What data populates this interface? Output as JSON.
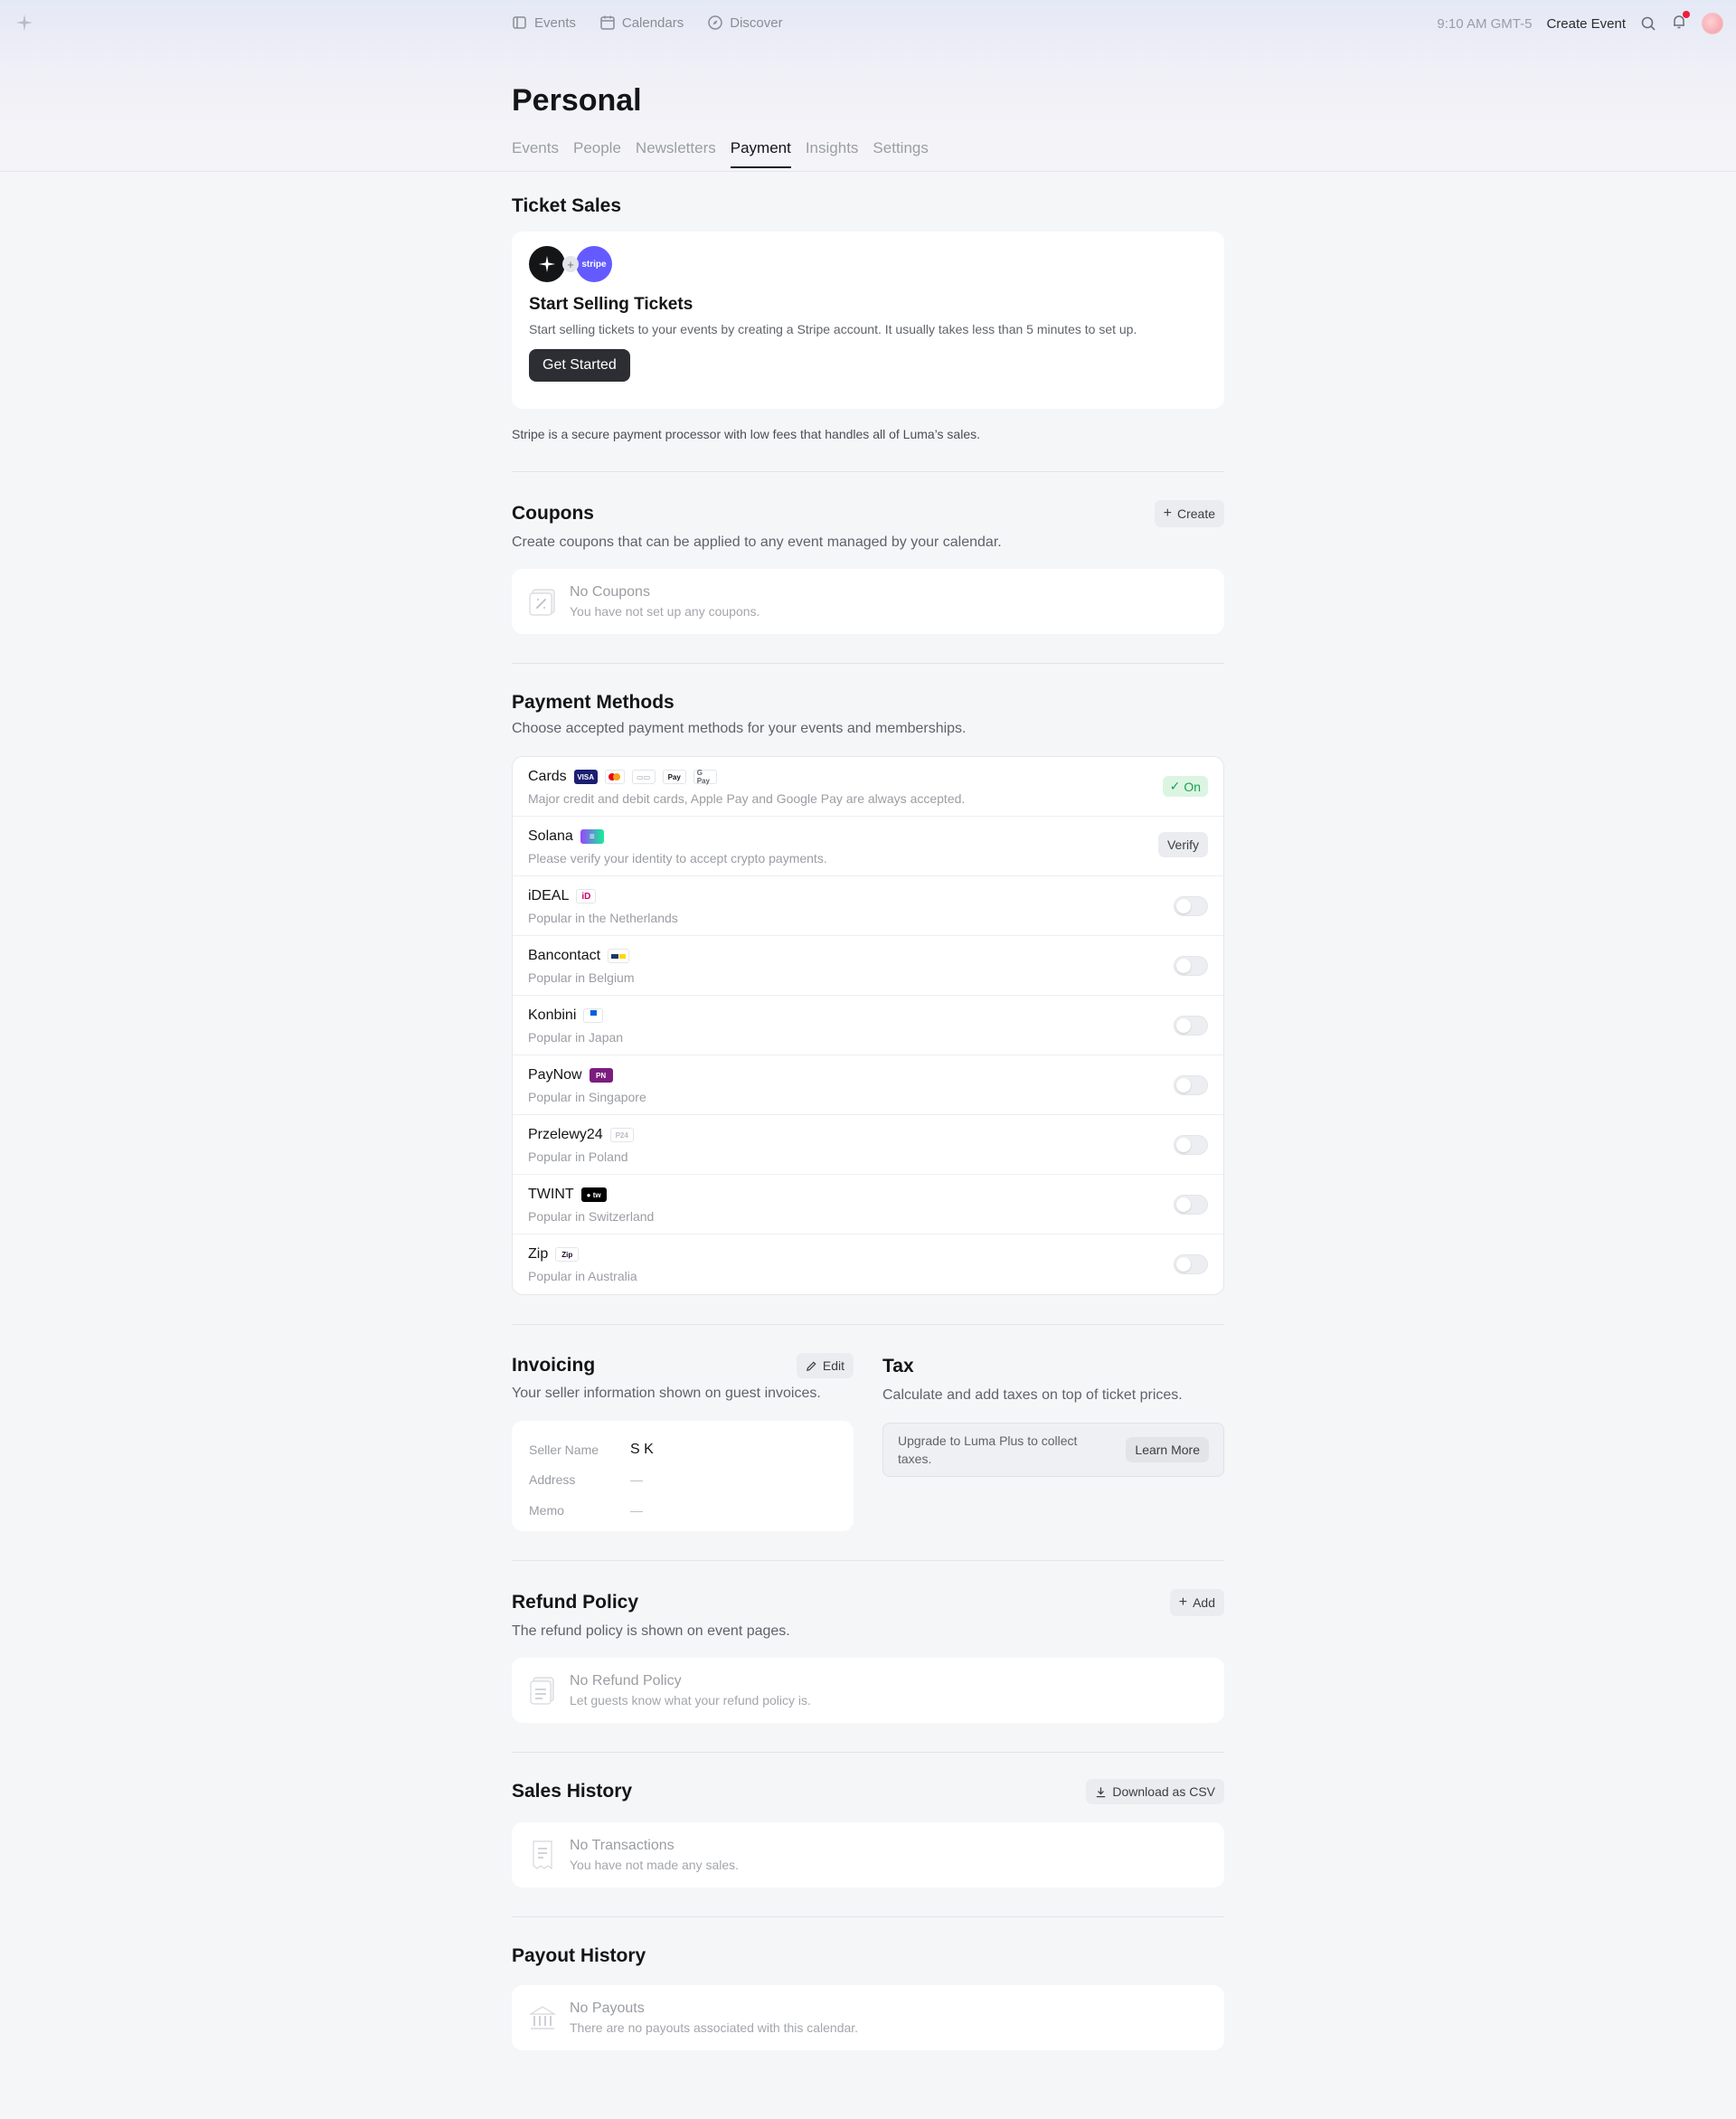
{
  "topbar": {
    "nav": [
      {
        "label": "Events",
        "icon": "ticket-icon"
      },
      {
        "label": "Calendars",
        "icon": "calendar-icon"
      },
      {
        "label": "Discover",
        "icon": "compass-icon"
      }
    ],
    "time": "9:10 AM GMT-5",
    "create_event": "Create Event"
  },
  "page": {
    "title": "Personal",
    "tabs": [
      "Events",
      "People",
      "Newsletters",
      "Payment",
      "Insights",
      "Settings"
    ],
    "active_tab": "Payment"
  },
  "ticket_sales": {
    "heading": "Ticket Sales",
    "stripe_label": "stripe",
    "card_title": "Start Selling Tickets",
    "card_desc": "Start selling tickets to your events by creating a Stripe account. It usually takes less than 5 minutes to set up.",
    "button": "Get Started",
    "footnote": "Stripe is a secure payment processor with low fees that handles all of Luma’s sales."
  },
  "coupons": {
    "heading": "Coupons",
    "button": "Create",
    "desc": "Create coupons that can be applied to any event managed by your calendar.",
    "empty_title": "No Coupons",
    "empty_sub": "You have not set up any coupons."
  },
  "payment_methods": {
    "heading": "Payment Methods",
    "desc": "Choose accepted payment methods for your events and memberships.",
    "cards": {
      "name": "Cards",
      "desc": "Major credit and debit cards, Apple Pay and Google Pay are always accepted.",
      "status": "On",
      "status_color": "#16a34a"
    },
    "solana": {
      "name": "Solana",
      "desc": "Please verify your identity to accept crypto payments.",
      "button": "Verify"
    },
    "methods": [
      {
        "name": "iDEAL",
        "desc": "Popular in the Netherlands",
        "enabled": false
      },
      {
        "name": "Bancontact",
        "desc": "Popular in Belgium",
        "enabled": false
      },
      {
        "name": "Konbini",
        "desc": "Popular in Japan",
        "enabled": false
      },
      {
        "name": "PayNow",
        "desc": "Popular in Singapore",
        "enabled": false
      },
      {
        "name": "Przelewy24",
        "desc": "Popular in Poland",
        "enabled": false
      },
      {
        "name": "TWINT",
        "desc": "Popular in Switzerland",
        "enabled": false
      },
      {
        "name": "Zip",
        "desc": "Popular in Australia",
        "enabled": false
      }
    ]
  },
  "invoicing": {
    "heading": "Invoicing",
    "button": "Edit",
    "desc": "Your seller information shown on guest invoices.",
    "seller_name_label": "Seller Name",
    "seller_name": "S K",
    "address_label": "Address",
    "address": "—",
    "memo_label": "Memo",
    "memo": "—"
  },
  "tax": {
    "heading": "Tax",
    "desc": "Calculate and add taxes on top of ticket prices.",
    "upgrade_text": "Upgrade to Luma Plus to collect taxes.",
    "button": "Learn More"
  },
  "refund_policy": {
    "heading": "Refund Policy",
    "button": "Add",
    "desc": "The refund policy is shown on event pages.",
    "empty_title": "No Refund Policy",
    "empty_sub": "Let guests know what your refund policy is."
  },
  "sales_history": {
    "heading": "Sales History",
    "button": "Download as CSV",
    "empty_title": "No Transactions",
    "empty_sub": "You have not made any sales."
  },
  "payout_history": {
    "heading": "Payout History",
    "empty_title": "No Payouts",
    "empty_sub": "There are no payouts associated with this calendar."
  }
}
